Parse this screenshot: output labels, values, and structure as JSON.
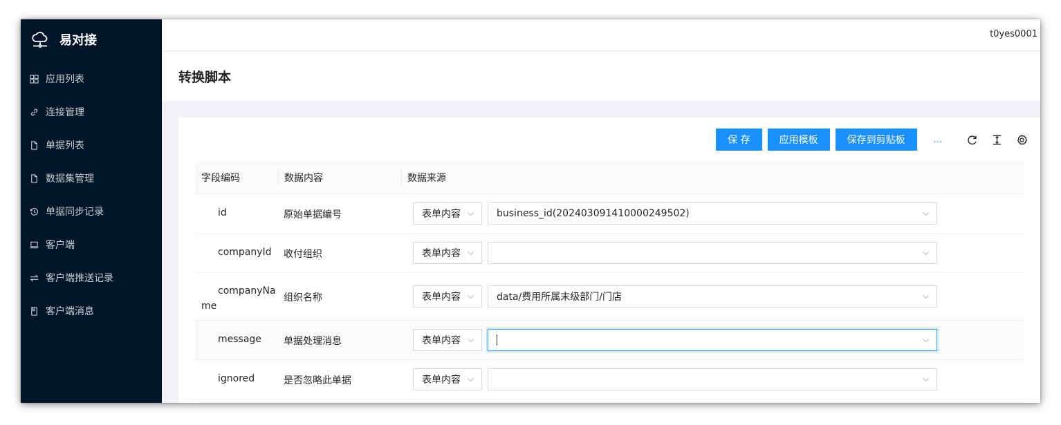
{
  "app": {
    "name": "易对接",
    "user": "t0yes0001"
  },
  "sidebar": {
    "items": [
      {
        "label": "应用列表",
        "icon": "grid-icon"
      },
      {
        "label": "连接管理",
        "icon": "link-icon"
      },
      {
        "label": "单据列表",
        "icon": "file-icon"
      },
      {
        "label": "数据集管理",
        "icon": "file-icon"
      },
      {
        "label": "单据同步记录",
        "icon": "history-icon"
      },
      {
        "label": "客户端",
        "icon": "laptop-icon"
      },
      {
        "label": "客户端推送记录",
        "icon": "swap-icon"
      },
      {
        "label": "客户端消息",
        "icon": "book-icon"
      }
    ]
  },
  "page": {
    "title": "转换脚本"
  },
  "toolbar": {
    "save_label": "保 存",
    "template_label": "应用模板",
    "clipboard_label": "保存到剪贴板",
    "more_label": "..."
  },
  "table": {
    "headers": [
      "字段编码",
      "数据内容",
      "数据来源"
    ],
    "rows": [
      {
        "code": "id",
        "content": "原始单据编号",
        "type": "表单内容",
        "value": "business_id(20240309141000024​9502)"
      },
      {
        "code": "companyId",
        "content": "收付组织",
        "type": "表单内容",
        "value": ""
      },
      {
        "code": "companyName",
        "content": "组织名称",
        "type": "表单内容",
        "value": "data/费用所属末级部门/门店"
      },
      {
        "code": "message",
        "content": "单据处理消息",
        "type": "表单内容",
        "value": ""
      },
      {
        "code": "ignored",
        "content": "是否忽略此单据",
        "type": "表单内容",
        "value": ""
      }
    ]
  },
  "colors": {
    "sidebar_bg": "#001529",
    "primary": "#1890ff"
  }
}
